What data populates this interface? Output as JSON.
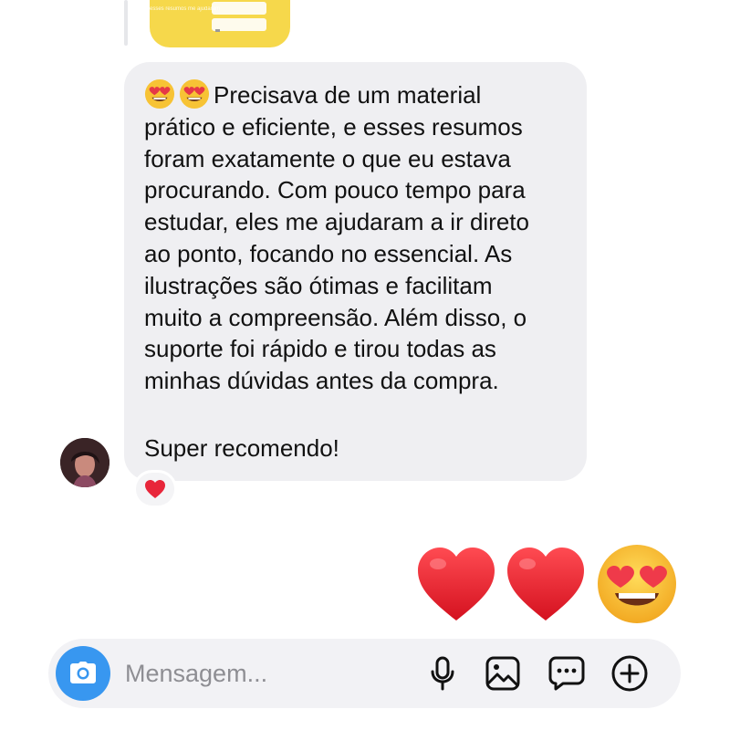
{
  "shared_image": {
    "caption": "esses resumos me ajudaram"
  },
  "message": {
    "emojis": [
      "smiling-face-with-heart-eyes",
      "smiling-face-with-heart-eyes"
    ],
    "paragraph": "Precisava de um material\nprático e eficiente, e esses resumos\nforam exatamente o que eu estava\nprocurando. Com pouco tempo para\nestudar, eles me ajudaram a ir direto\nao ponto, focando no essencial. As\nilustrações são ótimas e facilitam\nmuito a compreensão. Além disso, o\nsuporte foi rápido e tirou todas as\nminhas dúvidas antes da compra.",
    "signoff": "Super recomendo!",
    "reaction": "red-heart"
  },
  "sent_message": {
    "emojis": [
      "red-heart",
      "red-heart",
      "smiling-face-with-heart-eyes"
    ]
  },
  "composer": {
    "placeholder": "Mensagem...",
    "buttons": [
      "camera-icon",
      "microphone-icon",
      "gallery-icon",
      "sticker-icon",
      "plus-icon"
    ]
  },
  "colors": {
    "bubble": "#efeff2",
    "accent": "#3897f0",
    "text": "#111111",
    "placeholder": "#8e8e93"
  }
}
